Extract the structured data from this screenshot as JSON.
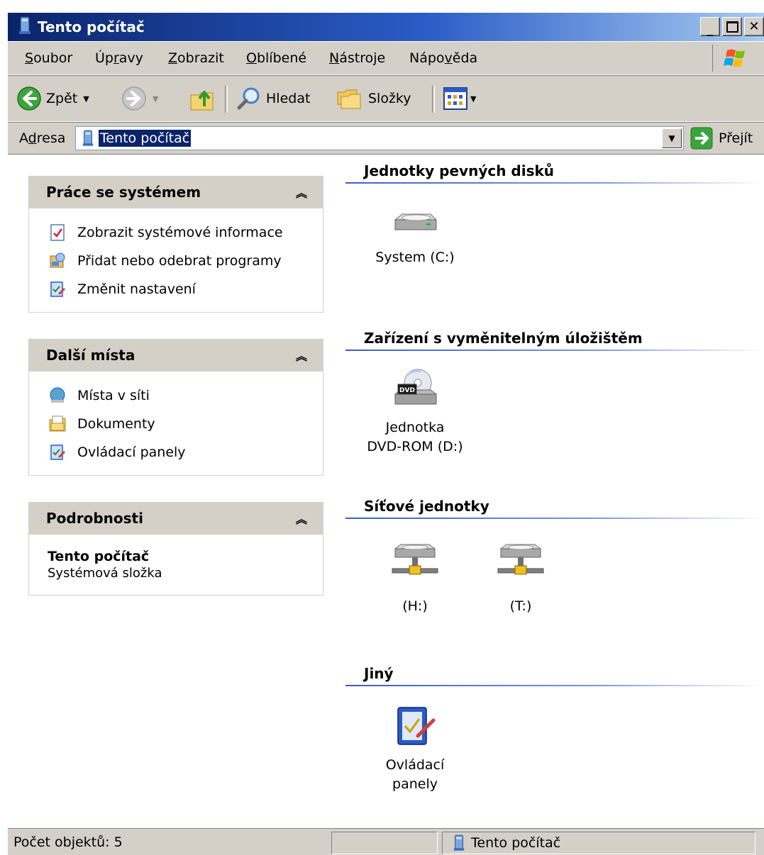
{
  "window": {
    "title": "Tento počítač"
  },
  "menu": {
    "items": [
      {
        "label": "Soubor",
        "accel": "S",
        "rest": "oubor"
      },
      {
        "label": "Úpravy",
        "pre": "Úp",
        "accel": "r",
        "rest": "avy"
      },
      {
        "label": "Zobrazit",
        "accel": "Z",
        "rest": "obrazit"
      },
      {
        "label": "Oblíbené",
        "accel": "O",
        "rest": "blíbené"
      },
      {
        "label": "Nástroje",
        "accel": "N",
        "rest": "ástroje"
      },
      {
        "label": "Nápověda",
        "pre": "Nápo",
        "accel": "v",
        "rest": "ěda"
      }
    ]
  },
  "toolbar": {
    "back_label": "Zpět",
    "search_label": "Hledat",
    "folders_label": "Složky"
  },
  "address": {
    "label_pre": "A",
    "label_accel": "d",
    "label_rest": "resa",
    "value": "Tento počítač",
    "go_label": "Přejít"
  },
  "tasks_panel": {
    "title": "Práce se systémem",
    "links": [
      {
        "label": "Zobrazit systémové informace",
        "icon": "system-info-icon"
      },
      {
        "label": "Přidat nebo odebrat programy",
        "icon": "add-remove-programs-icon"
      },
      {
        "label": "Změnit nastavení",
        "icon": "control-panel-icon"
      }
    ]
  },
  "places_panel": {
    "title": "Další místa",
    "links": [
      {
        "label": "Místa v síti",
        "icon": "network-places-icon"
      },
      {
        "label": "Dokumenty",
        "icon": "documents-icon"
      },
      {
        "label": "Ovládací panely",
        "icon": "control-panel-icon"
      }
    ]
  },
  "details_panel": {
    "title": "Podrobnosti",
    "item_name": "Tento počítač",
    "item_type": "Systémová složka"
  },
  "groups": {
    "hard_disks": {
      "title": "Jednotky pevných disků",
      "items": [
        {
          "label": "System (C:)"
        }
      ]
    },
    "removable": {
      "title": "Zařízení s vyměnitelným úložištěm",
      "items": [
        {
          "line1": "Jednotka",
          "line2": "DVD-ROM (D:)",
          "badge": "DVD"
        }
      ]
    },
    "network": {
      "title": "Síťové jednotky",
      "items": [
        {
          "label": "(H:)"
        },
        {
          "label": "(T:)"
        }
      ]
    },
    "other": {
      "title": "Jiný",
      "items": [
        {
          "line1": "Ovládací",
          "line2": "panely"
        }
      ]
    }
  },
  "status": {
    "count": "Počet objektů: 5",
    "location": "Tento počítač"
  },
  "colors": {
    "titlebar": "#0a246a",
    "face": "#d4d0c8",
    "selection": "#0a246a",
    "group_line": "#3a5fc8"
  }
}
